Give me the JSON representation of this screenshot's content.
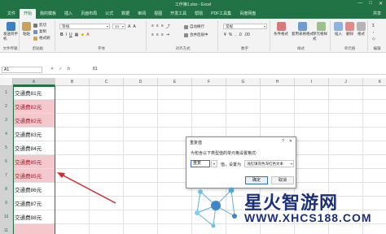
{
  "window": {
    "title": "工作簿1.xlsx - Excel",
    "buttons": [
      "—",
      "□",
      "✕"
    ]
  },
  "tabs": [
    "文件",
    "开始",
    "我的模板",
    "插入",
    "页面布局",
    "公式",
    "数据",
    "审阅",
    "视图",
    "开发工具",
    "帮助",
    "PDF工具集",
    "百度网盘"
  ],
  "active_tab": "开始",
  "share_label": "共享",
  "ribbon": {
    "groups": {
      "file_transfer": {
        "label": "文件传输",
        "btn": "发送到手机"
      },
      "clipboard": {
        "label": "剪贴板",
        "paste": "粘贴",
        "cut": "剪切",
        "copy": "复制",
        "format_painter": "格式刷"
      },
      "font": {
        "label": "字体",
        "font_name": "等线",
        "font_size": "14",
        "bold": "B",
        "italic": "I",
        "underline": "U"
      },
      "alignment": {
        "label": "对齐方式",
        "wrap": "自动换行",
        "merge": "合并后居中"
      },
      "number": {
        "label": "数字",
        "format": "常规"
      },
      "styles": {
        "label": "样式",
        "conditional": "条件格式",
        "table": "套用表格格式",
        "cell_styles": "单元格样式"
      },
      "cells": {
        "label": "单元格",
        "insert": "插入",
        "delete": "删除",
        "format": "格式"
      },
      "editing": {
        "label": "编辑"
      }
    }
  },
  "formula_bar": {
    "name_box": "A1",
    "fx": "fx",
    "content": "81"
  },
  "columns": [
    "A",
    "B",
    "C",
    "D",
    "E",
    "F",
    "G",
    "H",
    "I",
    "J",
    "K"
  ],
  "rows": [
    {
      "num": "1",
      "a": "交通费81元",
      "hl": false
    },
    {
      "num": "2",
      "a": "交通费82元",
      "hl": true
    },
    {
      "num": "3",
      "a": "交通费82元",
      "hl": true
    },
    {
      "num": "4",
      "a": "交通费83元",
      "hl": false
    },
    {
      "num": "5",
      "a": "交通费84元",
      "hl": false
    },
    {
      "num": "6",
      "a": "交通费85元",
      "hl": true
    },
    {
      "num": "7",
      "a": "交通费85元",
      "hl": true
    },
    {
      "num": "8",
      "a": "交通费86元",
      "hl": false
    },
    {
      "num": "9",
      "a": "交通费87元",
      "hl": false
    },
    {
      "num": "10",
      "a": "交通费88元",
      "hl": false
    },
    {
      "num": "11",
      "a": "",
      "hl": true
    }
  ],
  "dialog": {
    "title": "重复值",
    "help": "?",
    "close": "✕",
    "prompt": "为包含以下类型值的单元格设置格式:",
    "value_type": "重复",
    "mid_label": "值，设置为",
    "format_option": "浅红填充色深红色文本",
    "ok": "确定",
    "cancel": "取消"
  },
  "watermark": {
    "text": "星火智游网",
    "url": "WWW.XHCS188.COM"
  },
  "colors": {
    "excel_green": "#217346",
    "highlight_fill": "#f3c9cd",
    "highlight_text": "#9c1c28",
    "arrow": "#d12a2a"
  }
}
